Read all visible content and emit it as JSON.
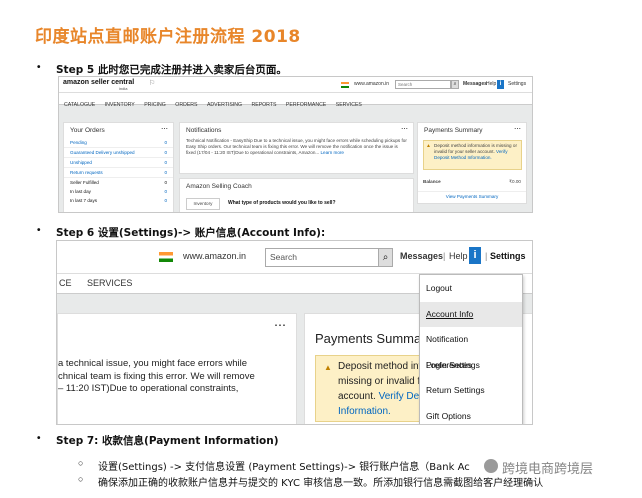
{
  "title": "印度站点直邮账户注册流程   2018",
  "step5": "Step 5 此时您已完成注册并进入卖家后台页面。",
  "step6": "Step 6 设置(Settings)-> 账户信息(Account Info):",
  "step7": "Step 7: 收款信息(Payment Information)",
  "sub1": "设置(Settings) -> 支付信息设置 (Payment Settings)-> 银行账户信息（Bank Ac",
  "sub2": "确保添加正确的收款账户信息并与提交的 KYC 审核信息一致。所添加银行信息需截图给客户经理确认",
  "watermark": "跨境电商跨境层",
  "sc1": {
    "logo": "amazon seller central",
    "logo_sub": "india",
    "domain": "www.amazon.in",
    "search_placeholder": "Search",
    "messages": "Messages",
    "help": "Help",
    "settings": "Settings",
    "nav": [
      "CATALOGUE",
      "INVENTORY",
      "PRICING",
      "ORDERS",
      "ADVERTISING",
      "REPORTS",
      "PERFORMANCE",
      "SERVICES"
    ],
    "orders_title": "Your Orders",
    "orders": [
      {
        "label": "Pending",
        "count": "0"
      },
      {
        "label": "Guaranteed Delivery unshipped",
        "count": "0"
      },
      {
        "label": "Unshipped",
        "count": "0"
      },
      {
        "label": "Return requests",
        "count": "0"
      }
    ],
    "orders_seller": "Seller Fulfilled",
    "orders_seller_count": "0",
    "last_day": "In last day",
    "last_day_count": "0",
    "last_7": "In last 7 days",
    "last_7_count": "0",
    "notif_title": "Notifications",
    "notif_text": "Technical Notification - EasyShip Due to a technical issue, you might face errors while scheduling pickups for Easy Ship orders. Our technical team is fixing this error. We will remove the notification once the issue is fixed (17/04 - 11:20 IST)Due to operational constraints, Amazon...",
    "notif_link": "Learn more",
    "coach_title": "Amazon Selling Coach",
    "coach_tab": "Inventory",
    "coach_q": "What type of products would you like to sell?",
    "pay_title": "Payments Summary",
    "pay_warn": "Deposit method information is missing or invalid for your seller account. ",
    "pay_warn_link": "Verify Deposit Method Information.",
    "balance": "Balance",
    "balance_val": "₹0.00",
    "view_pay": "View Payments Summary"
  },
  "sc2": {
    "domain": "www.amazon.in",
    "search_placeholder": "Search",
    "messages": "Messages",
    "help": "Help",
    "settings": "Settings",
    "nav_partial": "CE",
    "nav_services": "SERVICES",
    "notif_l1": "a technical issue, you might face errors while",
    "notif_l2": "chnical team is fixing this error. We will remove",
    "notif_l3": "– 11:20 IST)Due to operational constraints,",
    "pay_title": "Payments Summa",
    "warn_l1": "Deposit method inf",
    "warn_l2": "missing or invalid f",
    "warn_l3a": "account. ",
    "warn_l3b": "Verify Dep",
    "warn_l4": "Information.",
    "menu": [
      "Logout",
      "Account Info",
      "Notification Preferences",
      "Login Settings",
      "Return Settings",
      "Gift Options"
    ]
  }
}
